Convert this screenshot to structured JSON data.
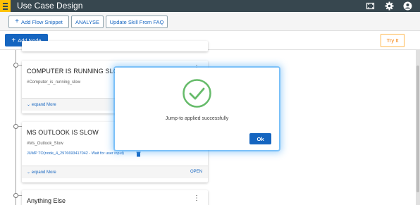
{
  "header": {
    "title": "Use Case Design",
    "menu_icon": "hamburger-menu-icon",
    "icons": [
      "fullscreen-icon",
      "settings-gear-icon",
      "account-icon"
    ]
  },
  "toolbar": {
    "add_flow_snippet": "Add Flow Snippet",
    "analyse": "ANALYSE",
    "update_skill": "Update Skill From FAQ"
  },
  "actions": {
    "add_node": "Add Node",
    "try_it": "Try It"
  },
  "nodes": [
    {
      "title": "COMPUTER IS RUNNING SLOW",
      "intent": "#Computer_is_running_slow",
      "expand": "expand More"
    },
    {
      "title": "MS OUTLOOK IS SLOW",
      "intent": "#Ms_Outlook_Slow",
      "jump": "JUMP TO(node_4_2976693417042 - Wait for user input)",
      "expand": "expand More",
      "open": "OPEN"
    },
    {
      "title": "Anything Else"
    }
  ],
  "dialog": {
    "message": "Jump-to applied successfully",
    "ok": "Ok"
  },
  "colors": {
    "header_bg": "#37474f",
    "accent_yellow": "#ffc107",
    "primary_blue": "#1565c0",
    "success_green": "#66bb6a",
    "try_orange": "#f57c00"
  }
}
